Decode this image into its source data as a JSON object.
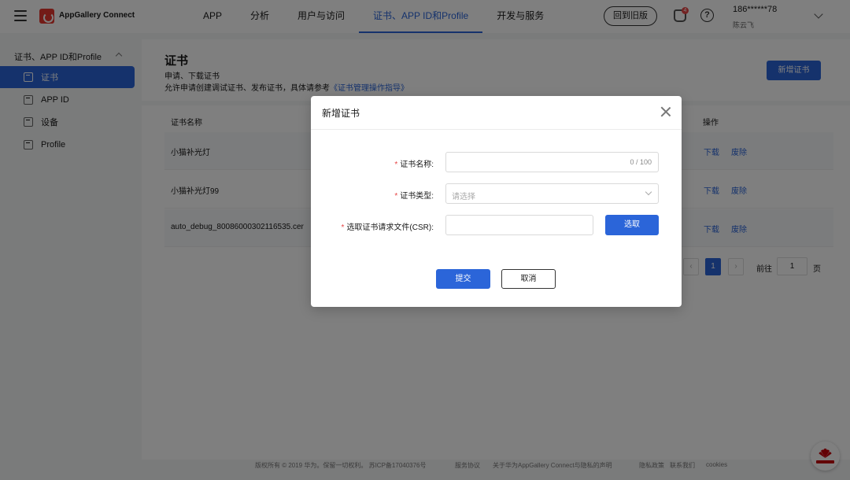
{
  "header": {
    "brand": "AppGallery Connect",
    "nav": [
      "APP",
      "分析",
      "用户与访问",
      "证书、APP ID和Profile",
      "开发与服务"
    ],
    "nav_active_index": 3,
    "old_version_btn": "回到旧版",
    "notification_count": "4",
    "help_symbol": "?",
    "user_id": "186******78",
    "user_name": "陈云飞"
  },
  "sidebar": {
    "group_label": "证书、APP ID和Profile",
    "items": [
      {
        "label": "证书",
        "active": true
      },
      {
        "label": "APP ID",
        "active": false
      },
      {
        "label": "设备",
        "active": false
      },
      {
        "label": "Profile",
        "active": false
      }
    ]
  },
  "page": {
    "title": "证书",
    "subtitle": "申请、下载证书",
    "desc_prefix": "允许申请创建调试证书、发布证书，具体请参考",
    "desc_link": "《证书管理操作指导》",
    "new_cert_btn": "新增证书"
  },
  "table": {
    "col_name": "证书名称",
    "col_action": "操作",
    "rows": [
      {
        "name": "小猫补光灯",
        "download": "下载",
        "revoke": "废除"
      },
      {
        "name": "小猫补光灯99",
        "download": "下载",
        "revoke": "废除"
      },
      {
        "name": "auto_debug_80086000302116535.cer",
        "download": "下载",
        "revoke": "废除"
      }
    ],
    "pagination": {
      "prev": "‹",
      "current": "1",
      "next": "›",
      "goto_label": "前往",
      "goto_value": "1",
      "page_suffix": "页"
    }
  },
  "footer": {
    "copyright": "版权所有 © 2019 华为。保留一切权利。 苏ICP备17040376号",
    "links": [
      "服务协议",
      "关于华为AppGallery Connect与隐私的声明",
      "隐私政策",
      "联系我们",
      "cookies"
    ]
  },
  "modal": {
    "title": "新增证书",
    "fields": {
      "name_label": "证书名称:",
      "name_counter": "0 / 100",
      "type_label": "证书类型:",
      "type_placeholder": "请选择",
      "csr_label": "选取证书请求文件(CSR):",
      "pick_btn": "选取"
    },
    "required_mark": "*",
    "submit_btn": "提交",
    "cancel_btn": "取消"
  },
  "colors": {
    "accent": "#2b65d9",
    "required": "#e64545",
    "brand_red": "#e6372f"
  }
}
